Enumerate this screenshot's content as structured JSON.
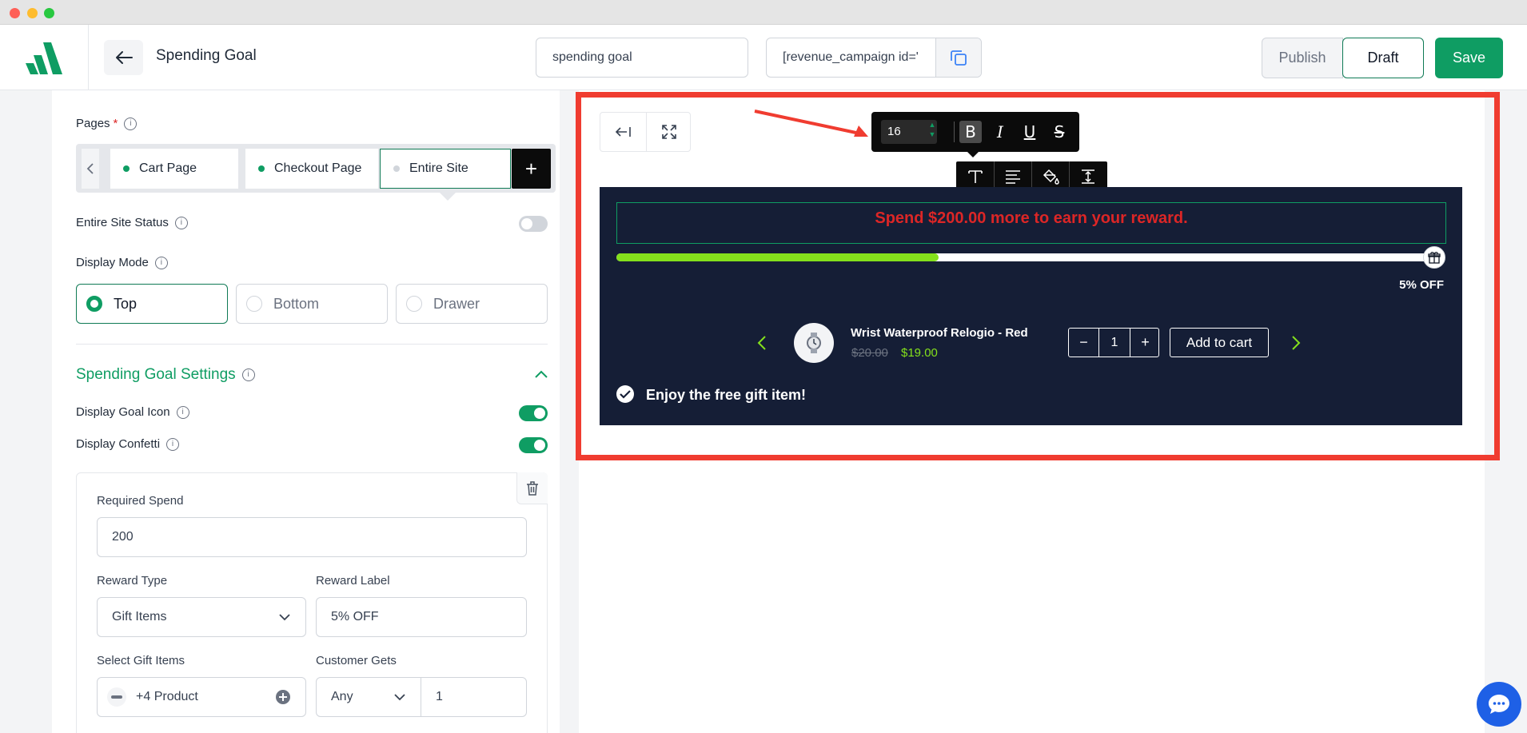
{
  "header": {
    "title": "Spending Goal",
    "name_value": "spending goal",
    "shortcode": "[revenue_campaign id='",
    "publish_label": "Publish",
    "draft_label": "Draft",
    "save_label": "Save"
  },
  "pages": {
    "label": "Pages",
    "required_mark": "*",
    "tabs": [
      {
        "label": "Cart Page",
        "status": "active"
      },
      {
        "label": "Checkout Page",
        "status": "active"
      },
      {
        "label": "Entire Site",
        "status": "inactive"
      }
    ],
    "add_label": "+"
  },
  "entire_site_status": {
    "label": "Entire Site Status",
    "enabled": false
  },
  "display_mode": {
    "label": "Display Mode",
    "options": [
      "Top",
      "Bottom",
      "Drawer"
    ],
    "selected": "Top"
  },
  "settings": {
    "title": "Spending Goal Settings",
    "display_goal_icon": {
      "label": "Display Goal Icon",
      "enabled": true
    },
    "display_confetti": {
      "label": "Display Confetti",
      "enabled": true
    }
  },
  "reward": {
    "required_spend_label": "Required Spend",
    "required_spend_value": "200",
    "reward_type_label": "Reward Type",
    "reward_type_value": "Gift Items",
    "reward_label_label": "Reward Label",
    "reward_label_value": "5% OFF",
    "select_gift_label": "Select Gift Items",
    "select_gift_value": "+4 Product",
    "customer_gets_label": "Customer Gets",
    "customer_gets_scope": "Any",
    "customer_gets_qty": "1"
  },
  "toolbar": {
    "font_size": "16",
    "bold": "B",
    "italic": "I",
    "underline": "U",
    "strike": "S"
  },
  "preview": {
    "goal_message": "Spend $200.00 more to earn your reward.",
    "progress": 0.395,
    "reward_label": "5% OFF",
    "product_name": "Wrist Waterproof Relogio - Red",
    "old_price": "$20.00",
    "new_price": "$19.00",
    "qty": "1",
    "qty_minus": "−",
    "qty_plus": "+",
    "add_to_cart": "Add to cart",
    "gift_message": "Enjoy the free gift item!"
  },
  "colors": {
    "brand": "#0f9d63",
    "banner_bg": "#151e36",
    "goal_text": "#dc2626",
    "progress_fill": "#84e01c",
    "highlight_frame": "#f03c30"
  }
}
